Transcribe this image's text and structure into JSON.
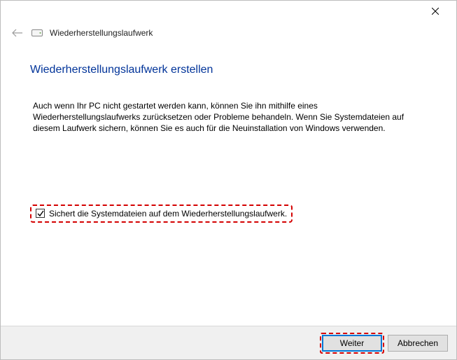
{
  "window": {
    "title": "Wiederherstellungslaufwerk"
  },
  "page": {
    "heading": "Wiederherstellungslaufwerk erstellen",
    "body": "Auch wenn Ihr PC nicht gestartet werden kann, können Sie ihn mithilfe eines Wiederherstellungslaufwerks zurücksetzen oder Probleme behandeln. Wenn Sie Systemdateien auf diesem Laufwerk sichern, können Sie es auch für die Neuinstallation von Windows verwenden."
  },
  "checkbox": {
    "label": "Sichert die Systemdateien auf dem Wiederherstellungslaufwerk.",
    "checked": true
  },
  "buttons": {
    "next": "Weiter",
    "cancel": "Abbrechen"
  }
}
